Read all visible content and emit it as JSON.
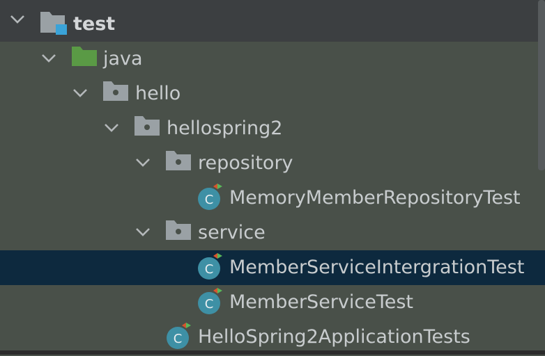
{
  "tree": {
    "nodes": [
      {
        "label": "test",
        "icon": "test-folder-icon",
        "expanded": true
      },
      {
        "label": "java",
        "icon": "test-source-root-icon",
        "expanded": true
      },
      {
        "label": "hello",
        "icon": "package-icon",
        "expanded": true
      },
      {
        "label": "hellospring2",
        "icon": "package-icon",
        "expanded": true
      },
      {
        "label": "repository",
        "icon": "package-icon",
        "expanded": true
      },
      {
        "label": "MemoryMemberRepositoryTest",
        "icon": "test-class-icon"
      },
      {
        "label": "service",
        "icon": "package-icon",
        "expanded": true
      },
      {
        "label": "MemberServiceIntergrationTest",
        "icon": "test-class-icon",
        "selected": true
      },
      {
        "label": "MemberServiceTest",
        "icon": "test-class-icon"
      },
      {
        "label": "HelloSpring2ApplicationTests",
        "icon": "test-class-icon"
      }
    ],
    "class_glyph": "C"
  },
  "colors": {
    "panel_bg": "#3c3f41",
    "test_scope_bg": "#495049",
    "selection_bg": "#0d293e",
    "text": "#c8ccce",
    "folder_gray": "#9aa1a5",
    "source_root_green": "#5a9a45",
    "class_teal": "#3e90a5",
    "test_badge_blue": "#3aa3d8"
  }
}
